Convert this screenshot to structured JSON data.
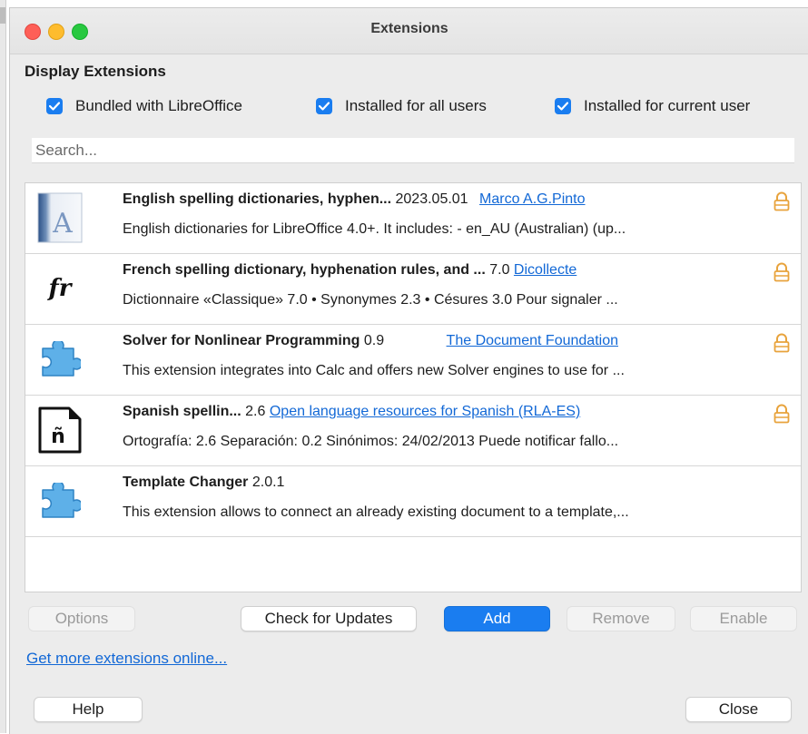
{
  "window": {
    "title": "Extensions"
  },
  "display": {
    "heading": "Display Extensions",
    "filters": [
      {
        "label": "Bundled with LibreOffice",
        "checked": true
      },
      {
        "label": "Installed for all users",
        "checked": true
      },
      {
        "label": "Installed for current user",
        "checked": true
      }
    ]
  },
  "search": {
    "placeholder": "Search...",
    "value": ""
  },
  "extensions": [
    {
      "name": "English spelling dictionaries, hyphen...",
      "version": "2023.05.01",
      "author": "Marco A.G.Pinto",
      "description": "English dictionaries for LibreOffice 4.0+.  It includes: - en_AU (Australian) (up...",
      "icon": "dictionary-a-icon",
      "locked": true
    },
    {
      "name": "French spelling dictionary, hyphenation rules, and ...",
      "version": "7.0",
      "author": "Dicollecte",
      "description": "Dictionnaire «Classique» 7.0 • Synonymes 2.3 • Césures 3.0   Pour signaler ...",
      "icon": "fr-icon",
      "locked": true
    },
    {
      "name": "Solver for Nonlinear Programming",
      "version": "0.9",
      "author": "The Document Foundation",
      "description": "This extension integrates into Calc and offers new Solver engines to use for ...",
      "icon": "puzzle-piece-icon",
      "locked": true
    },
    {
      "name": "Spanish spellin...",
      "version": "2.6",
      "author": "Open language resources for Spanish (RLA-ES)",
      "description": "Ortografía: 2.6 Separación: 0.2 Sinónimos: 24/02/2013  Puede notificar fallo...",
      "icon": "n-tilde-icon",
      "locked": true
    },
    {
      "name": "Template Changer",
      "version": "2.0.1",
      "author": "",
      "description": "This extension allows to connect an already existing document to a template,...",
      "icon": "puzzle-piece-icon",
      "locked": false
    }
  ],
  "buttons": {
    "options": "Options",
    "check_updates": "Check for Updates",
    "add": "Add",
    "remove": "Remove",
    "enable": "Enable",
    "help": "Help",
    "close": "Close"
  },
  "links": {
    "get_more": "Get more extensions online..."
  },
  "colors": {
    "accent": "#1a7df0",
    "link": "#1268d6",
    "lock": "#e8a33c",
    "puzzle": "#5eb0e8"
  }
}
